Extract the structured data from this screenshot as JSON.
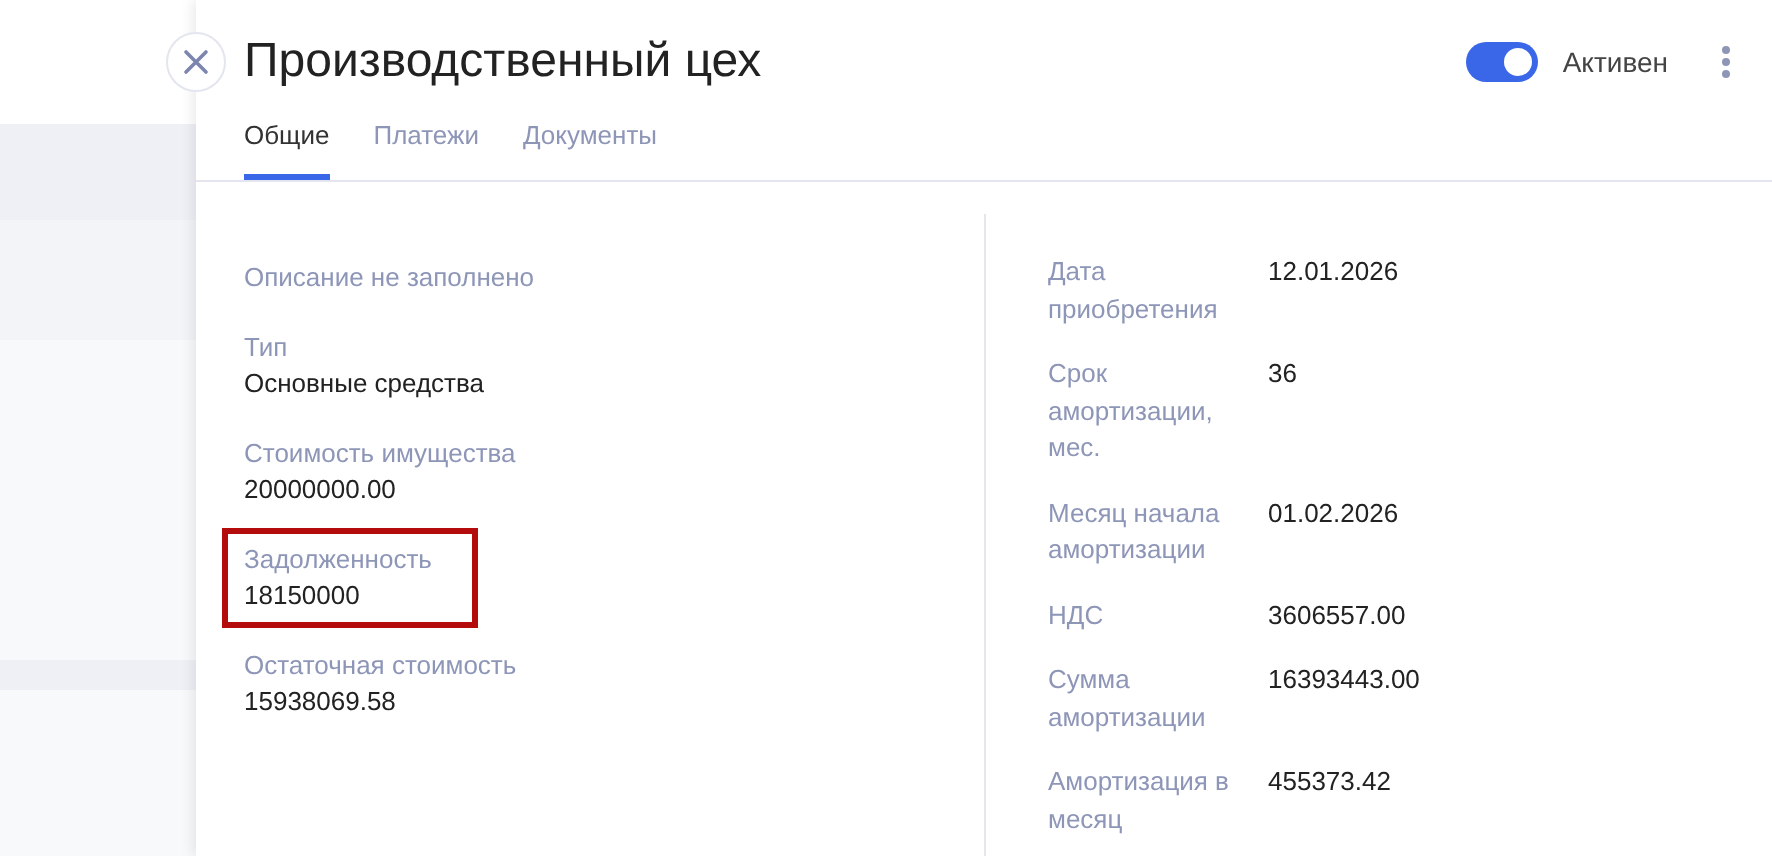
{
  "panel": {
    "title": "Производственный цех",
    "status": {
      "label": "Активен",
      "on": true
    }
  },
  "tabs": [
    {
      "label": "Общие",
      "selected": true
    },
    {
      "label": "Платежи",
      "selected": false
    },
    {
      "label": "Документы",
      "selected": false
    }
  ],
  "left_fields": [
    {
      "kind": "note",
      "label": "Описание не заполнено",
      "highlighted": false
    },
    {
      "kind": "field",
      "label": "Тип",
      "value": "Основные средства",
      "highlighted": false
    },
    {
      "kind": "field",
      "label": "Стоимость имущества",
      "value": "20000000.00",
      "highlighted": false
    },
    {
      "kind": "field",
      "label": "Задолженность",
      "value": "18150000",
      "highlighted": true
    },
    {
      "kind": "field",
      "label": "Остаточная стоимость",
      "value": "15938069.58",
      "highlighted": false
    }
  ],
  "right_fields": [
    {
      "label": "Дата приобретения",
      "value": "12.01.2026"
    },
    {
      "label": "Срок амортизации, мес.",
      "value": "36"
    },
    {
      "label": "Месяц начала амортизации",
      "value": "01.02.2026"
    },
    {
      "label": "НДС",
      "value": "3606557.00"
    },
    {
      "label": "Сумма амортизации",
      "value": "16393443.00"
    },
    {
      "label": "Амортизация в месяц",
      "value": "455373.42"
    }
  ]
}
